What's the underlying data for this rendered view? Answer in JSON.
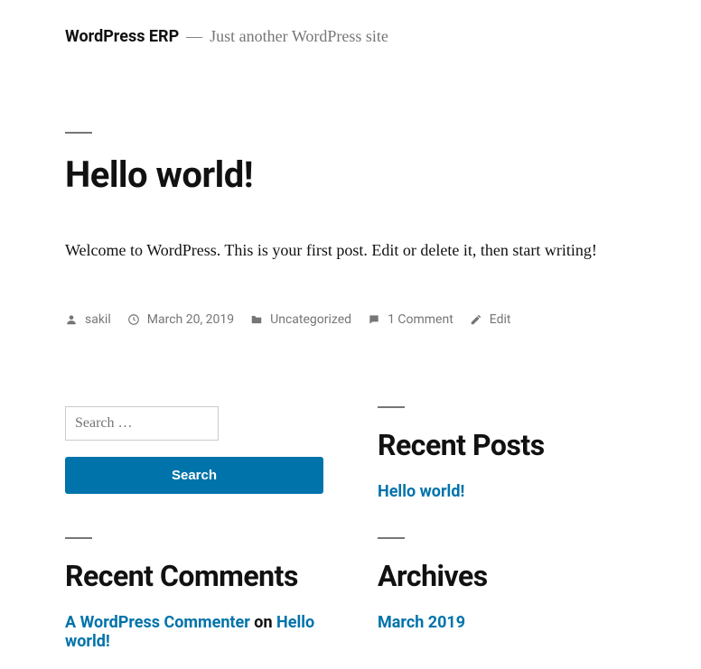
{
  "header": {
    "site_title": "WordPress ERP",
    "dash": "—",
    "tagline": "Just another WordPress site"
  },
  "post": {
    "title": "Hello world!",
    "content": "Welcome to WordPress. This is your first post. Edit or delete it, then start writing!",
    "meta": {
      "author": "sakil",
      "date": "March 20, 2019",
      "category": "Uncategorized",
      "comments": "1 Comment",
      "edit": "Edit"
    }
  },
  "search": {
    "placeholder": "Search …",
    "button": "Search"
  },
  "widgets": {
    "recent_posts": {
      "title": "Recent Posts",
      "item": "Hello world!"
    },
    "recent_comments": {
      "title": "Recent Comments",
      "commenter": "A WordPress Commenter",
      "on": " on ",
      "post": "Hello world!"
    },
    "archives": {
      "title": "Archives",
      "item": "March 2019"
    }
  }
}
